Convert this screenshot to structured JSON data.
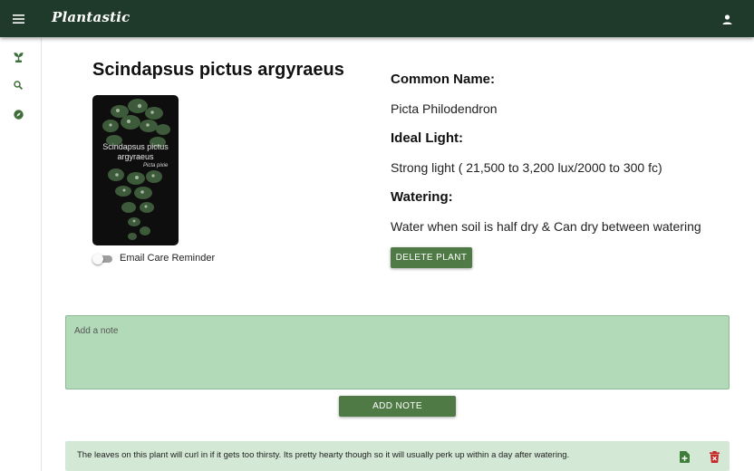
{
  "appbar": {
    "logo": "Plantastic",
    "menu_icon": "hamburger-menu-icon",
    "account_icon": "account-icon",
    "color": "#1f3a2a"
  },
  "rail": {
    "items": [
      {
        "icon": "seedling-icon"
      },
      {
        "icon": "search-icon"
      },
      {
        "icon": "explore-compass-icon"
      }
    ]
  },
  "plant": {
    "title": "Scindapsus pictus argyraeus",
    "image_caption_line1": "Scindapsus pictus",
    "image_caption_line2": "argyraeus",
    "image_caption_line3": "Picta pixie",
    "reminder_label": "Email Care Reminder",
    "reminder_on": false
  },
  "info": {
    "common_name_label": "Common Name:",
    "common_name": "Picta Philodendron",
    "light_label": "Ideal Light:",
    "light": "Strong light ( 21,500 to 3,200 lux/2000 to 300 fc)",
    "watering_label": "Watering:",
    "watering": "Water when soil is half dry & Can dry between watering",
    "delete_label": "DELETE PLANT"
  },
  "notes": {
    "placeholder": "Add a note",
    "add_label": "ADD NOTE",
    "items": [
      {
        "text": "The leaves on this plant will curl in if it gets too thirsty. Its pretty hearty though so it will usually perk up within a day after watering.",
        "edit_icon": "note-add-icon",
        "delete_icon": "trash-icon"
      }
    ]
  },
  "colors": {
    "accent": "#4f7a45",
    "note_bg": "#b2dab8",
    "note_card_bg": "#d4e8d6",
    "delete_icon": "#c62828"
  }
}
